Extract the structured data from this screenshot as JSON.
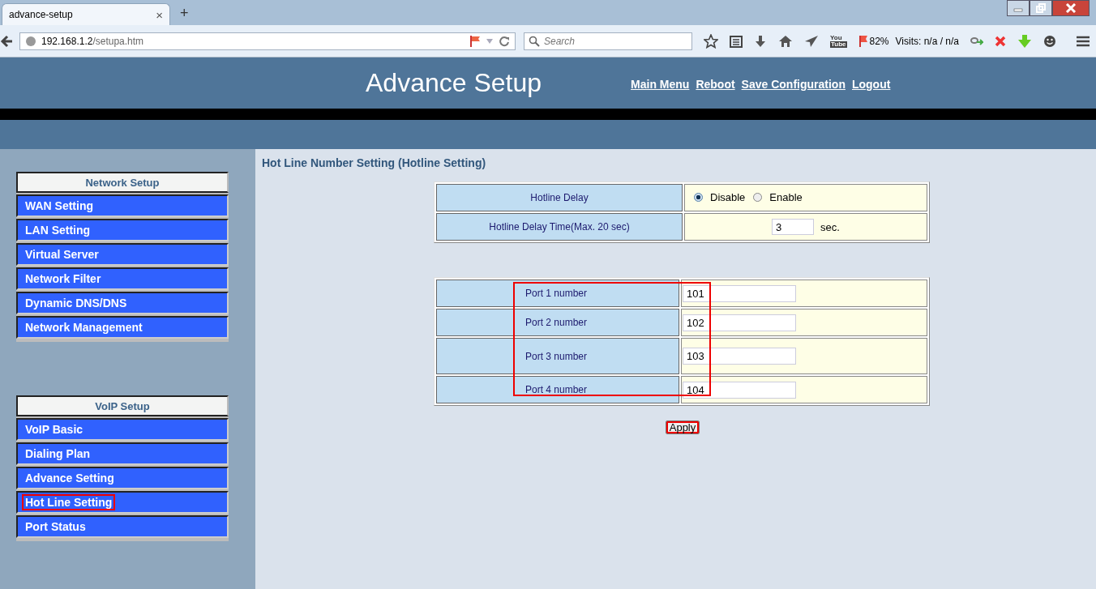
{
  "browser": {
    "tab": {
      "title": "advance-setup",
      "close": "×",
      "new": "+"
    },
    "address": {
      "host": "192.168.1.2",
      "path": "/setupa.htm"
    },
    "search": {
      "placeholder": "Search"
    },
    "toolbar": {
      "video_badge_top": "You",
      "video_badge_bottom": "Tube",
      "flag_percent": "82%",
      "visits": "Visits: n/a / n/a"
    }
  },
  "header": {
    "title": "Advance Setup",
    "links": [
      {
        "label": "Main Menu"
      },
      {
        "label": "Reboot"
      },
      {
        "label": "Save Configuration"
      },
      {
        "label": "Logout"
      }
    ]
  },
  "sidebar": {
    "groups": [
      {
        "title": "Network Setup",
        "items": [
          {
            "label": "WAN Setting",
            "highlighted": false
          },
          {
            "label": "LAN Setting",
            "highlighted": false
          },
          {
            "label": "Virtual Server",
            "highlighted": false
          },
          {
            "label": "Network Filter",
            "highlighted": false
          },
          {
            "label": "Dynamic DNS/DNS",
            "highlighted": false
          },
          {
            "label": "Network Management",
            "highlighted": false
          }
        ]
      },
      {
        "title": "VoIP Setup",
        "items": [
          {
            "label": "VoIP Basic",
            "highlighted": false
          },
          {
            "label": "Dialing Plan",
            "highlighted": false
          },
          {
            "label": "Advance Setting",
            "highlighted": false
          },
          {
            "label": "Hot Line Setting",
            "highlighted": true
          },
          {
            "label": "Port Status",
            "highlighted": false
          }
        ]
      }
    ]
  },
  "content": {
    "title": "Hot Line Number Setting (Hotline Setting)",
    "settings": [
      {
        "kind": "radio",
        "label": "Hotline Delay",
        "options": [
          {
            "label": "Disable",
            "selected": true
          },
          {
            "label": "Enable",
            "selected": false
          }
        ]
      },
      {
        "kind": "number",
        "label": "Hotline Delay Time(Max. 20 sec)",
        "value": "3",
        "unit": "sec."
      }
    ],
    "ports": {
      "highlighted": true,
      "rows": [
        {
          "label": "Port 1 number",
          "value": "101"
        },
        {
          "label": "Port 2 number",
          "value": "102"
        },
        {
          "label": "Port 3 number",
          "value": "103"
        },
        {
          "label": "Port 4 number",
          "value": "104"
        }
      ]
    },
    "apply": {
      "label": "Apply",
      "highlighted": true
    }
  }
}
